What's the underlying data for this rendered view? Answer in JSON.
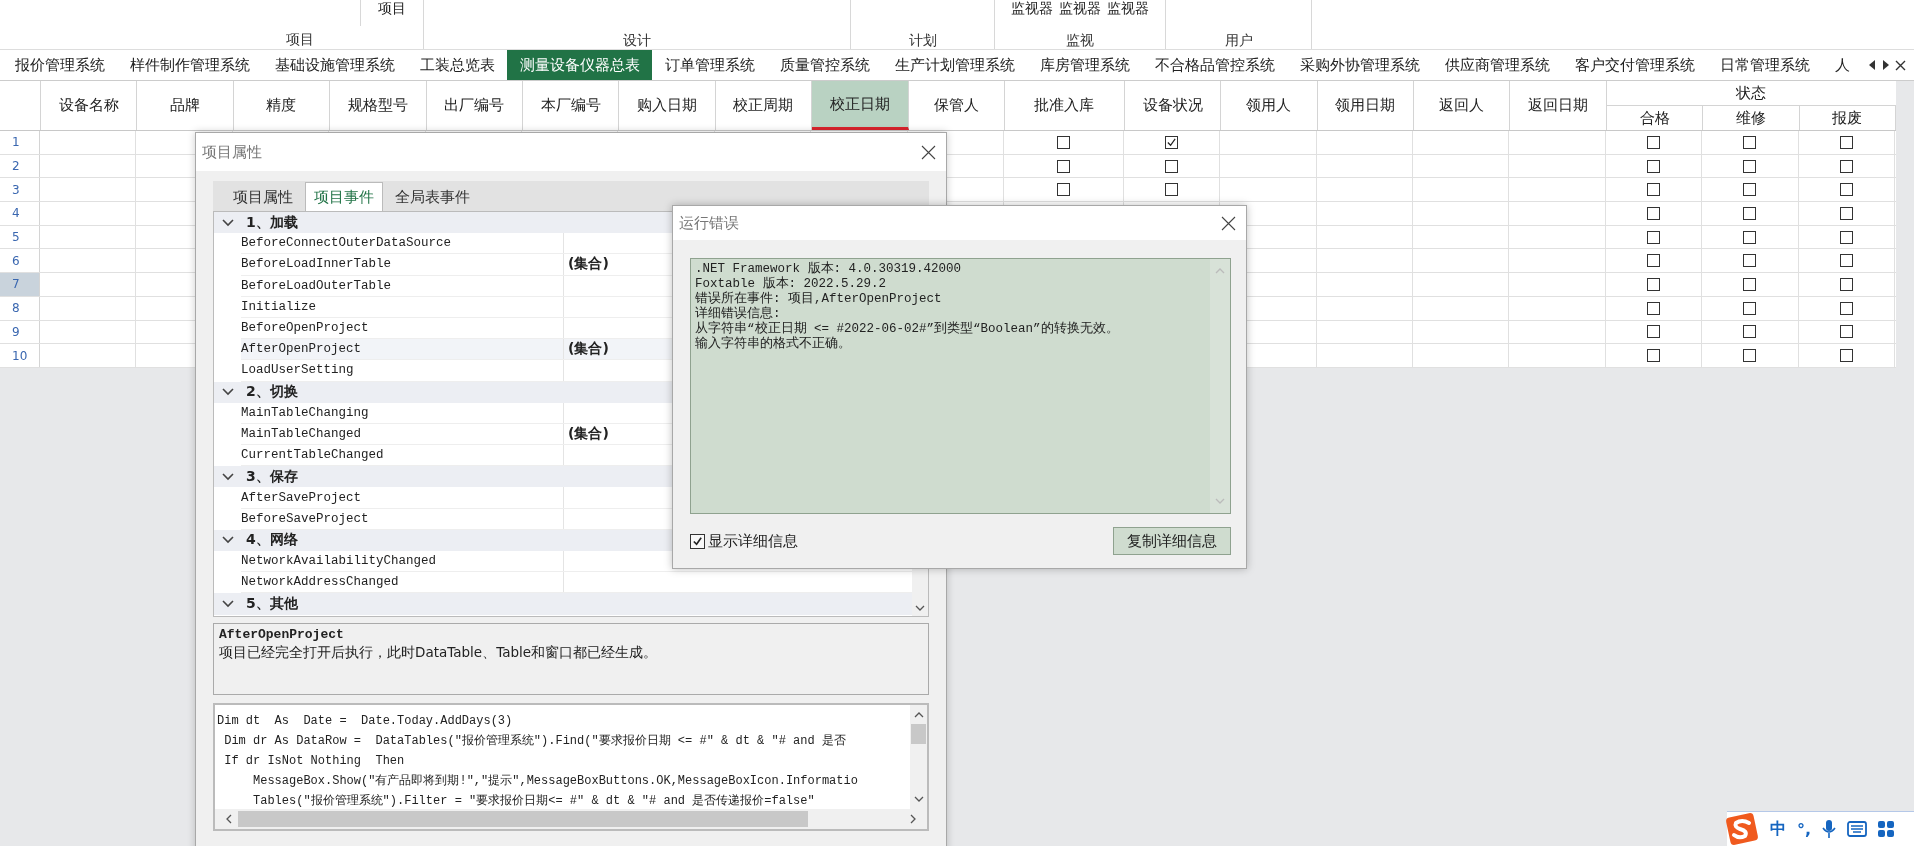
{
  "ribbon": {
    "groups": [
      {
        "label": "项目",
        "buttons": [
          "项目"
        ]
      },
      {
        "label": "设计"
      },
      {
        "label": "计划"
      },
      {
        "label": "监视",
        "buttons": [
          "监视器",
          "监视器",
          "监视器"
        ]
      },
      {
        "label": "用户"
      }
    ]
  },
  "sheet_tabs": [
    {
      "label": "报价管理系统",
      "selected": false
    },
    {
      "label": "样件制作管理系统",
      "selected": false
    },
    {
      "label": "基础设施管理系统",
      "selected": false
    },
    {
      "label": "工装总览表",
      "selected": false
    },
    {
      "label": "测量设备仪器总表",
      "selected": true
    },
    {
      "label": "订单管理系统",
      "selected": false
    },
    {
      "label": "质量管控系统",
      "selected": false
    },
    {
      "label": "生产计划管理系统",
      "selected": false
    },
    {
      "label": "库房管理系统",
      "selected": false
    },
    {
      "label": "不合格品管控系统",
      "selected": false
    },
    {
      "label": "采购外协管理系统",
      "selected": false
    },
    {
      "label": "供应商管理系统",
      "selected": false
    },
    {
      "label": "客户交付管理系统",
      "selected": false
    },
    {
      "label": "日常管理系统",
      "selected": false
    },
    {
      "label": "人",
      "selected": false
    }
  ],
  "table": {
    "columns": [
      {
        "label": "设备名称",
        "selected": false
      },
      {
        "label": "品牌",
        "selected": false
      },
      {
        "label": "精度",
        "selected": false
      },
      {
        "label": "规格型号",
        "selected": false
      },
      {
        "label": "出厂编号",
        "selected": false
      },
      {
        "label": "本厂编号",
        "selected": false
      },
      {
        "label": "购入日期",
        "selected": false
      },
      {
        "label": "校正周期",
        "selected": false
      },
      {
        "label": "校正日期",
        "selected": true
      },
      {
        "label": "保管人",
        "selected": false
      },
      {
        "label": "批准入库",
        "selected": false
      },
      {
        "label": "设备状况",
        "selected": false
      },
      {
        "label": "领用人",
        "selected": false
      },
      {
        "label": "领用日期",
        "selected": false
      },
      {
        "label": "返回人",
        "selected": false
      },
      {
        "label": "返回日期",
        "selected": false
      }
    ],
    "status_group": {
      "label": "状态",
      "columns": [
        "合格",
        "维修",
        "报废"
      ]
    },
    "rows": [
      {
        "number": "1",
        "selected": false,
        "approved": false,
        "condition": true,
        "status": [
          false,
          false,
          false
        ]
      },
      {
        "number": "2",
        "selected": false,
        "approved": false,
        "condition": false,
        "status": [
          false,
          false,
          false
        ]
      },
      {
        "number": "3",
        "selected": false,
        "approved": false,
        "condition": false,
        "status": [
          false,
          false,
          false
        ]
      },
      {
        "number": "4",
        "selected": false,
        "status": [
          false,
          false,
          false
        ]
      },
      {
        "number": "5",
        "selected": false,
        "status": [
          false,
          false,
          false
        ]
      },
      {
        "number": "6",
        "selected": false,
        "status": [
          false,
          false,
          false
        ]
      },
      {
        "number": "7",
        "selected": true,
        "status": [
          false,
          false,
          false
        ]
      },
      {
        "number": "8",
        "selected": false,
        "status": [
          false,
          false,
          false
        ]
      },
      {
        "number": "9",
        "selected": false,
        "status": [
          false,
          false,
          false
        ]
      },
      {
        "number": "10",
        "selected": false,
        "status": [
          false,
          false,
          false
        ]
      }
    ]
  },
  "project_dialog": {
    "title": "项目属性",
    "tabs": [
      {
        "label": "项目属性",
        "selected": false
      },
      {
        "label": "项目事件",
        "selected": true
      },
      {
        "label": "全局表事件",
        "selected": false
      }
    ],
    "categories": [
      {
        "label": "1、加载",
        "expanded": true,
        "events": [
          {
            "name": "BeforeConnectOuterDataSource",
            "selected": false
          },
          {
            "name": "BeforeLoadInnerTable",
            "value": "(集合)",
            "selected": false
          },
          {
            "name": "BeforeLoadOuterTable",
            "selected": false
          },
          {
            "name": "Initialize",
            "selected": false
          },
          {
            "name": "BeforeOpenProject",
            "selected": false
          },
          {
            "name": "AfterOpenProject",
            "value": "(集合)",
            "selected": true
          },
          {
            "name": "LoadUserSetting",
            "selected": false
          }
        ]
      },
      {
        "label": "2、切换",
        "expanded": true,
        "events": [
          {
            "name": "MainTableChanging",
            "selected": false
          },
          {
            "name": "MainTableChanged",
            "value": "(集合)",
            "selected": false
          },
          {
            "name": "CurrentTableChanged",
            "selected": false
          }
        ]
      },
      {
        "label": "3、保存",
        "expanded": true,
        "events": [
          {
            "name": "AfterSaveProject",
            "selected": false
          },
          {
            "name": "BeforeSaveProject",
            "selected": false
          }
        ]
      },
      {
        "label": "4、网络",
        "expanded": true,
        "events": [
          {
            "name": "NetworkAvailabilityChanged",
            "selected": false
          },
          {
            "name": "NetworkAddressChanged",
            "selected": false
          }
        ]
      },
      {
        "label": "5、其他",
        "expanded": true
      }
    ],
    "description": {
      "title": "AfterOpenProject",
      "text": "项目已经完全打开后执行，此时DataTable、Table和窗口都已经生成。"
    },
    "code_lines": [
      "Dim dt  As  Date =  Date.Today.AddDays(3)",
      " Dim dr As DataRow =  DataTables(\"报价管理系统\").Find(\"要求报价日期 <= #\" & dt & \"# and 是否",
      " If dr IsNot Nothing  Then",
      "     MessageBox.Show(\"有产品即将到期!\",\"提示\",MessageBoxButtons.OK,MessageBoxIcon.Informatio",
      "     Tables(\"报价管理系统\").Filter = \"要求报价日期<= #\" & dt & \"# and 是否传递报价=false\""
    ]
  },
  "error_dialog": {
    "title": "运行错误",
    "details": [
      ".NET Framework 版本: 4.0.30319.42000",
      "Foxtable 版本: 2022.5.29.2",
      "错误所在事件: 项目,AfterOpenProject",
      "详细错误信息:",
      "从字符串“校正日期 <= #2022-06-02#”到类型“Boolean”的转换无效。",
      "输入字符串的格式不正确。"
    ],
    "show_details": {
      "label": "显示详细信息",
      "checked": true
    },
    "copy_button": "复制详细信息"
  },
  "ime_bar": {
    "items": [
      "中",
      "°,"
    ]
  }
}
